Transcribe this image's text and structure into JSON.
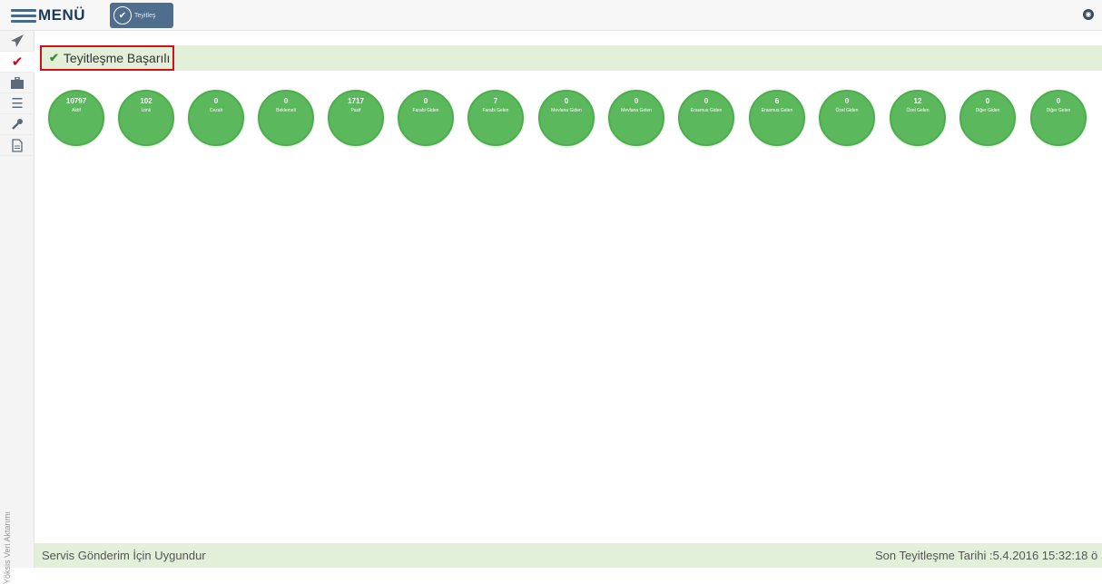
{
  "header": {
    "menu_label": "MENÜ",
    "teyit_button_label": "Teyitleş",
    "accent_color": "#4f6d8c"
  },
  "sidebar": {
    "items": [
      {
        "icon": "send-icon"
      },
      {
        "icon": "check-icon",
        "active": true
      },
      {
        "icon": "briefcase-icon"
      },
      {
        "icon": "list-icon"
      },
      {
        "icon": "wrench-icon"
      },
      {
        "icon": "document-icon"
      }
    ],
    "vertical_label": "Yöksis Veri Aktarımı"
  },
  "status": {
    "success_text": "Teyitleşme Başarılı",
    "success_color": "#e2f0da"
  },
  "stats": [
    {
      "value": "10797",
      "label": "Aktif"
    },
    {
      "value": "102",
      "label": "İzinli"
    },
    {
      "value": "0",
      "label": "Cezalı"
    },
    {
      "value": "0",
      "label": "Beklemeli"
    },
    {
      "value": "1717",
      "label": "Pasif"
    },
    {
      "value": "0",
      "label": "Farabi Giden"
    },
    {
      "value": "7",
      "label": "Farabi Gelen"
    },
    {
      "value": "0",
      "label": "Mevlana Giden"
    },
    {
      "value": "0",
      "label": "Mevlana Gelen"
    },
    {
      "value": "0",
      "label": "Erasmus Giden"
    },
    {
      "value": "6",
      "label": "Erasmus Gelen"
    },
    {
      "value": "0",
      "label": "Özel Giden"
    },
    {
      "value": "12",
      "label": "Özel Gelen"
    },
    {
      "value": "0",
      "label": "Diğer Giden"
    },
    {
      "value": "0",
      "label": "Diğer Gelen"
    }
  ],
  "footer": {
    "left_text": "Servis Gönderim İçin Uygundur",
    "right_text": "Son Teyitleşme Tarihi :5.4.2016 15:32:18 ö"
  }
}
